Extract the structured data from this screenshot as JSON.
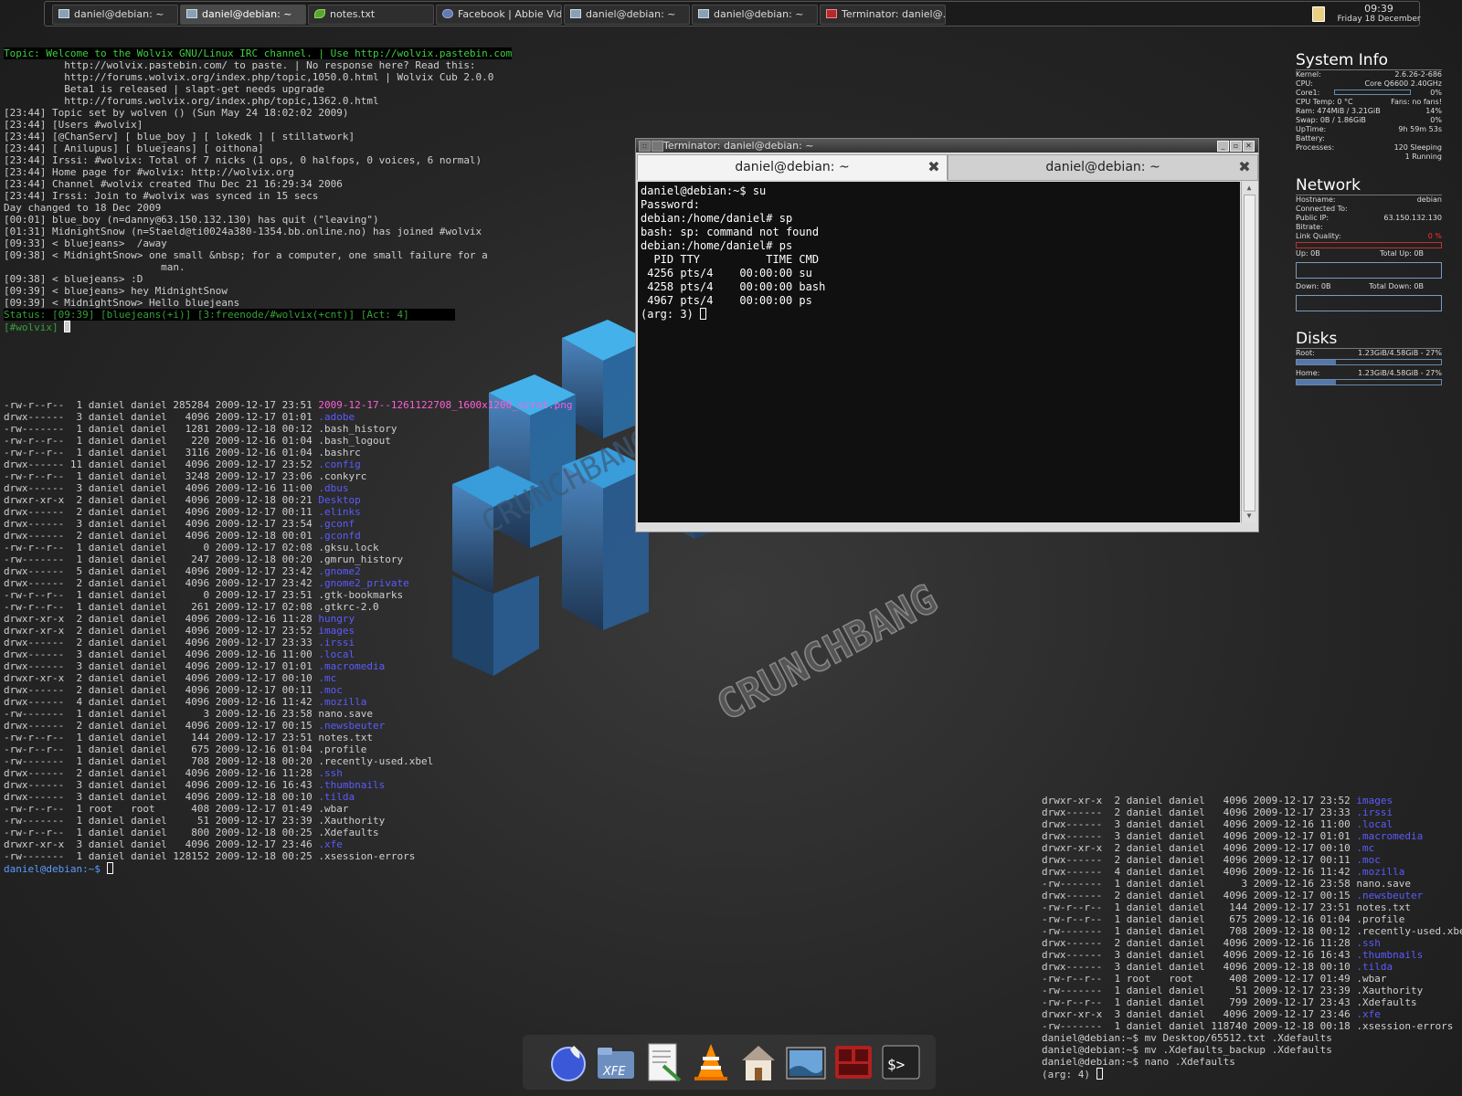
{
  "taskbar": {
    "tasks": [
      {
        "label": "daniel@debian: ~",
        "icon": "terminal-icon"
      },
      {
        "label": "daniel@debian: ~",
        "icon": "terminal-icon"
      },
      {
        "label": "notes.txt",
        "icon": "leaf-icon"
      },
      {
        "label": "Facebook | Abbie Vid...",
        "icon": "browser-icon"
      },
      {
        "label": "daniel@debian: ~",
        "icon": "terminal-icon"
      },
      {
        "label": "daniel@debian: ~",
        "icon": "terminal-icon"
      },
      {
        "label": "Terminator: daniel@...",
        "icon": "terminator-icon"
      }
    ],
    "clock_time": "09:39",
    "clock_date": "Friday 18 December"
  },
  "irc": {
    "lines": [
      {
        "text": "Topic: Welcome to the Wolvix GNU/Linux IRC channel. | Use http://wolvix.pastebin.com",
        "style": "topic"
      },
      {
        "text": "          http://wolvix.pastebin.com/ to paste. | No response here? Read this:"
      },
      {
        "text": "          http://forums.wolvix.org/index.php/topic,1050.0.html | Wolvix Cub 2.0.0"
      },
      {
        "text": "          Beta1 is released | slapt-get needs upgrade"
      },
      {
        "text": "          http://forums.wolvix.org/index.php/topic,1362.0.html"
      },
      {
        "text": "[23:44] Topic set by wolven () (Sun May 24 18:02:02 2009)"
      },
      {
        "text": "[23:44] [Users #wolvix]"
      },
      {
        "text": "[23:44] [@ChanServ] [ blue_boy ] [ lokedk ] [ stillatwork]"
      },
      {
        "text": "[23:44] [ Anilupus] [ bluejeans] [ oithona]"
      },
      {
        "text": "[23:44] Irssi: #wolvix: Total of 7 nicks (1 ops, 0 halfops, 0 voices, 6 normal)"
      },
      {
        "text": "[23:44] Home page for #wolvix: http://wolvix.org"
      },
      {
        "text": "[23:44] Channel #wolvix created Thu Dec 21 16:29:34 2006"
      },
      {
        "text": "[23:44] Irssi: Join to #wolvix was synced in 15 secs"
      },
      {
        "text": "Day changed to 18 Dec 2009"
      },
      {
        "text": "[00:01] blue_boy (n=danny@63.150.132.130) has quit (\"leaving\")"
      },
      {
        "text": "[01:31] MidnightSnow (n=Staeld@ti0024a380-1354.bb.online.no) has joined #wolvix"
      },
      {
        "text": "[09:33] < bluejeans>  /away"
      },
      {
        "text": "[09:38] < MidnightSnow> one small &nbsp; for a computer, one small failure for a"
      },
      {
        "text": "                          man."
      },
      {
        "text": "[09:38] < bluejeans> :D"
      },
      {
        "text": "[09:39] < bluejeans> hey MidnightSnow"
      },
      {
        "text": "[09:39] < MidnightSnow> Hello bluejeans"
      },
      {
        "text": "Status: [09:39] [bluejeans(+i)] [3:freenode/#wolvix(+cnt)] [Act: 4]",
        "style": "status"
      },
      {
        "text": "[#wolvix] ",
        "style": "prompt"
      }
    ]
  },
  "listing_left": [
    [
      "-rw-r--r--  1 daniel daniel 285284 2009-12-17 23:51 ",
      "2009-12-17--1261122708_1600x1200_scrot.png",
      "pk"
    ],
    [
      "drwx------  3 daniel daniel   4096 2009-12-17 01:01 ",
      ".adobe",
      "bl"
    ],
    [
      "-rw-------  1 daniel daniel   1281 2009-12-18 00:12 ",
      ".bash_history",
      "n"
    ],
    [
      "-rw-r--r--  1 daniel daniel    220 2009-12-16 01:04 ",
      ".bash_logout",
      "n"
    ],
    [
      "-rw-r--r--  1 daniel daniel   3116 2009-12-16 01:04 ",
      ".bashrc",
      "n"
    ],
    [
      "drwx------ 11 daniel daniel   4096 2009-12-17 23:52 ",
      ".config",
      "bl"
    ],
    [
      "-rw-r--r--  1 daniel daniel   3248 2009-12-17 23:06 ",
      ".conkyrc",
      "n"
    ],
    [
      "drwx------  3 daniel daniel   4096 2009-12-16 11:00 ",
      ".dbus",
      "bl"
    ],
    [
      "drwxr-xr-x  2 daniel daniel   4096 2009-12-18 00:21 ",
      "Desktop",
      "bl"
    ],
    [
      "drwx------  2 daniel daniel   4096 2009-12-17 00:11 ",
      ".elinks",
      "bl"
    ],
    [
      "drwx------  3 daniel daniel   4096 2009-12-17 23:54 ",
      ".gconf",
      "bl"
    ],
    [
      "drwx------  2 daniel daniel   4096 2009-12-18 00:01 ",
      ".gconfd",
      "bl"
    ],
    [
      "-rw-r--r--  1 daniel daniel      0 2009-12-17 02:08 ",
      ".gksu.lock",
      "n"
    ],
    [
      "-rw-------  1 daniel daniel    247 2009-12-18 00:20 ",
      ".gmrun_history",
      "n"
    ],
    [
      "drwx------  5 daniel daniel   4096 2009-12-17 23:42 ",
      ".gnome2",
      "bl"
    ],
    [
      "drwx------  2 daniel daniel   4096 2009-12-17 23:42 ",
      ".gnome2_private",
      "bl"
    ],
    [
      "-rw-r--r--  1 daniel daniel      0 2009-12-17 23:51 ",
      ".gtk-bookmarks",
      "n"
    ],
    [
      "-rw-r--r--  1 daniel daniel    261 2009-12-17 02:08 ",
      ".gtkrc-2.0",
      "n"
    ],
    [
      "drwxr-xr-x  2 daniel daniel   4096 2009-12-16 11:28 ",
      "hungry",
      "bl"
    ],
    [
      "drwxr-xr-x  2 daniel daniel   4096 2009-12-17 23:52 ",
      "images",
      "bl"
    ],
    [
      "drwx------  2 daniel daniel   4096 2009-12-17 23:33 ",
      ".irssi",
      "bl"
    ],
    [
      "drwx------  3 daniel daniel   4096 2009-12-16 11:00 ",
      ".local",
      "bl"
    ],
    [
      "drwx------  3 daniel daniel   4096 2009-12-17 01:01 ",
      ".macromedia",
      "bl"
    ],
    [
      "drwxr-xr-x  2 daniel daniel   4096 2009-12-17 00:10 ",
      ".mc",
      "bl"
    ],
    [
      "drwx------  2 daniel daniel   4096 2009-12-17 00:11 ",
      ".moc",
      "bl"
    ],
    [
      "drwx------  4 daniel daniel   4096 2009-12-16 11:42 ",
      ".mozilla",
      "bl"
    ],
    [
      "-rw-------  1 daniel daniel      3 2009-12-16 23:58 ",
      "nano.save",
      "n"
    ],
    [
      "drwx------  2 daniel daniel   4096 2009-12-17 00:15 ",
      ".newsbeuter",
      "bl"
    ],
    [
      "-rw-r--r--  1 daniel daniel    144 2009-12-17 23:51 ",
      "notes.txt",
      "n"
    ],
    [
      "-rw-r--r--  1 daniel daniel    675 2009-12-16 01:04 ",
      ".profile",
      "n"
    ],
    [
      "-rw-------  1 daniel daniel    708 2009-12-18 00:20 ",
      ".recently-used.xbel",
      "n"
    ],
    [
      "drwx------  2 daniel daniel   4096 2009-12-16 11:28 ",
      ".ssh",
      "bl"
    ],
    [
      "drwx------  3 daniel daniel   4096 2009-12-16 16:43 ",
      ".thumbnails",
      "bl"
    ],
    [
      "drwx------  3 daniel daniel   4096 2009-12-18 00:10 ",
      ".tilda",
      "bl"
    ],
    [
      "-rw-r--r--  1 root   root      408 2009-12-17 01:49 ",
      ".wbar",
      "n"
    ],
    [
      "-rw-------  1 daniel daniel     51 2009-12-17 23:39 ",
      ".Xauthority",
      "n"
    ],
    [
      "-rw-r--r--  1 daniel daniel    800 2009-12-18 00:25 ",
      ".Xdefaults",
      "n"
    ],
    [
      "drwxr-xr-x  3 daniel daniel   4096 2009-12-17 23:46 ",
      ".xfe",
      "bl"
    ],
    [
      "-rw-------  1 daniel daniel 128152 2009-12-18 00:25 ",
      ".xsession-errors",
      "n"
    ]
  ],
  "listing_left_prompt": "daniel@debian:~$ ",
  "listing_right": [
    [
      "drwxr-xr-x  2 daniel daniel   4096 2009-12-17 23:52 ",
      "images",
      "bl"
    ],
    [
      "drwx------  2 daniel daniel   4096 2009-12-17 23:33 ",
      ".irssi",
      "bl"
    ],
    [
      "drwx------  3 daniel daniel   4096 2009-12-16 11:00 ",
      ".local",
      "bl"
    ],
    [
      "drwx------  3 daniel daniel   4096 2009-12-17 01:01 ",
      ".macromedia",
      "bl"
    ],
    [
      "drwxr-xr-x  2 daniel daniel   4096 2009-12-17 00:10 ",
      ".mc",
      "bl"
    ],
    [
      "drwx------  2 daniel daniel   4096 2009-12-17 00:11 ",
      ".moc",
      "bl"
    ],
    [
      "drwx------  4 daniel daniel   4096 2009-12-16 11:42 ",
      ".mozilla",
      "bl"
    ],
    [
      "-rw-------  1 daniel daniel      3 2009-12-16 23:58 ",
      "nano.save",
      "n"
    ],
    [
      "drwx------  2 daniel daniel   4096 2009-12-17 00:15 ",
      ".newsbeuter",
      "bl"
    ],
    [
      "-rw-r--r--  1 daniel daniel    144 2009-12-17 23:51 ",
      "notes.txt",
      "n"
    ],
    [
      "-rw-r--r--  1 daniel daniel    675 2009-12-16 01:04 ",
      ".profile",
      "n"
    ],
    [
      "-rw-------  1 daniel daniel    708 2009-12-18 00:12 ",
      ".recently-used.xbel",
      "n"
    ],
    [
      "drwx------  2 daniel daniel   4096 2009-12-16 11:28 ",
      ".ssh",
      "bl"
    ],
    [
      "drwx------  3 daniel daniel   4096 2009-12-16 16:43 ",
      ".thumbnails",
      "bl"
    ],
    [
      "drwx------  3 daniel daniel   4096 2009-12-18 00:10 ",
      ".tilda",
      "bl"
    ],
    [
      "-rw-r--r--  1 root   root      408 2009-12-17 01:49 ",
      ".wbar",
      "n"
    ],
    [
      "-rw-------  1 daniel daniel     51 2009-12-17 23:39 ",
      ".Xauthority",
      "n"
    ],
    [
      "-rw-r--r--  1 daniel daniel    799 2009-12-17 23:43 ",
      ".Xdefaults",
      "n"
    ],
    [
      "drwxr-xr-x  3 daniel daniel   4096 2009-12-17 23:46 ",
      ".xfe",
      "bl"
    ],
    [
      "-rw-------  1 daniel daniel 118740 2009-12-18 00:18 ",
      ".xsession-errors",
      "n"
    ]
  ],
  "listing_right_tail": [
    "daniel@debian:~$ mv Desktop/65512.txt .Xdefaults",
    "daniel@debian:~$ mv .Xdefaults_backup .Xdefaults",
    "daniel@debian:~$ nano .Xdefaults",
    "(arg: 4) "
  ],
  "conky": {
    "system": {
      "title": "System Info",
      "rows": [
        {
          "k": "Kernel:",
          "v": "2.6.26-2-686"
        },
        {
          "k": "CPU:",
          "v": "Core Q6600 2.40GHz"
        },
        {
          "k": "Core1:",
          "v": "0%"
        },
        {
          "k": "CPU Temp:  0 °C",
          "v": "Fans:  no fans!"
        },
        {
          "k": "Ram:       474MiB  / 3.21GiB",
          "v": "14%"
        },
        {
          "k": "Swap:      0B     / 1.86GiB",
          "v": "0%"
        },
        {
          "k": "UpTime:",
          "v": "9h 59m 53s"
        },
        {
          "k": "Battery:",
          "v": ""
        },
        {
          "k": "Processes:",
          "v": "120  Sleeping"
        },
        {
          "k": "",
          "v": "1   Running"
        }
      ],
      "core1_usage": 0
    },
    "network": {
      "title": "Network",
      "rows": [
        {
          "k": "Hostname:",
          "v": "debian"
        },
        {
          "k": "Connected To:",
          "v": ""
        },
        {
          "k": "Public IP:",
          "v": "63.150.132.130"
        },
        {
          "k": "Bitrate:",
          "v": ""
        },
        {
          "k": "Link Quality:",
          "v": "0  %"
        }
      ],
      "up_label": "Up:  0B",
      "total_up_label": "Total Up:  0B",
      "down_label": "Down:  0B",
      "total_down_label": "Total Down:  0B"
    },
    "disks": {
      "title": "Disks",
      "root_label": "Root:",
      "root_value": "1.23GiB/4.58GiB - 27%",
      "root_pct": 27,
      "home_label": "Home:",
      "home_value": "1.23GiB/4.58GiB - 27%",
      "home_pct": 27
    }
  },
  "terminator": {
    "title": "Terminator: daniel@debian: ~",
    "tab1": "daniel@debian: ~",
    "tab2": "daniel@debian: ~",
    "lines": [
      "daniel@debian:~$ su",
      "Password:",
      "debian:/home/daniel# sp",
      "bash: sp: command not found",
      "debian:/home/daniel# ps",
      "  PID TTY          TIME CMD",
      " 4256 pts/4    00:00:00 su",
      " 4258 pts/4    00:00:00 bash",
      " 4967 pts/4    00:00:00 ps"
    ],
    "last_line": "(arg: 3) "
  },
  "dock": {
    "items": [
      "browser-globe-icon",
      "xfe-file-manager-icon",
      "text-editor-icon",
      "vlc-icon",
      "home-folder-icon",
      "desktop-preview-icon",
      "terminator-app-icon",
      "terminal-app-icon"
    ]
  }
}
